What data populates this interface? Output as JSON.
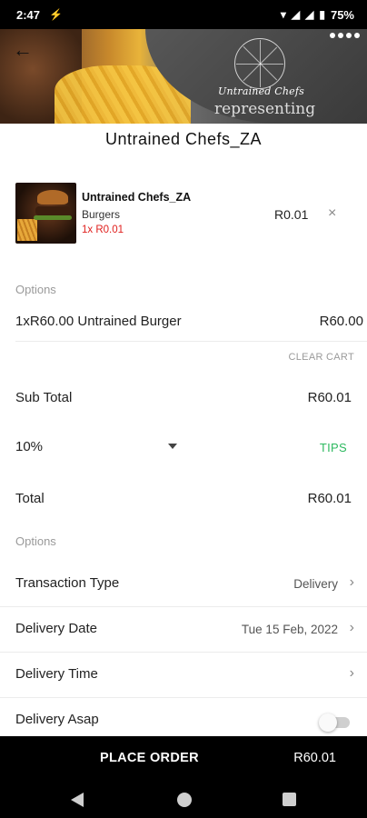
{
  "status_bar": {
    "time": "2:47",
    "battery": "75%",
    "accent": "#000000"
  },
  "hero": {
    "logo_text": "Untrained Chefs",
    "banner_text": "representing"
  },
  "restaurant": {
    "title": "Untrained Chefs_ZA"
  },
  "cart_item": {
    "name": "Untrained Chefs_ZA",
    "category": "Burgers",
    "quantity_price": "1x R0.01",
    "price": "R0.01",
    "remove_glyph": "×"
  },
  "options_section": {
    "heading": "Options",
    "line_description": "1xR60.00 Untrained Burger",
    "line_price": "R60.00",
    "clear_cart_label": "CLEAR CART"
  },
  "summary": {
    "subtotal_label": "Sub Total",
    "subtotal_value": "R60.01",
    "tips_selected": "10%",
    "tips_label": "TIPS",
    "total_label": "Total",
    "total_value": "R60.01"
  },
  "order_options": {
    "heading": "Options",
    "rows": [
      {
        "label": "Transaction Type",
        "value": "Delivery"
      },
      {
        "label": "Delivery Date",
        "value": "Tue 15 Feb, 2022"
      },
      {
        "label": "Delivery Time",
        "value": ""
      },
      {
        "label": "Delivery Asap",
        "value": ""
      }
    ],
    "delivery_asap_enabled": false
  },
  "place_order": {
    "label": "PLACE ORDER",
    "total": "R60.01"
  },
  "colors": {
    "tips_green": "#2db95f",
    "qty_red": "#e0201e",
    "bar_black": "#000000"
  },
  "icons": {
    "back": "arrow-left-icon",
    "more": "more-dots-icon",
    "chevron": "chevron-right-icon",
    "remove": "close-icon",
    "dropdown": "caret-down-icon"
  }
}
